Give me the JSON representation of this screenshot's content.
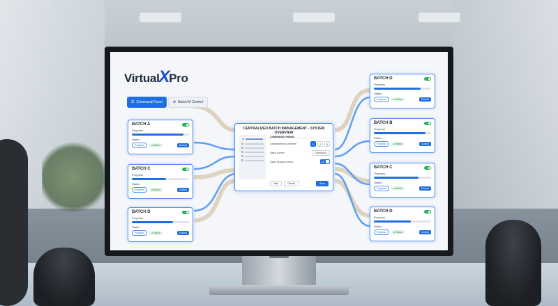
{
  "brand": {
    "name_prefix": "Virtual",
    "name_x": "X",
    "name_suffix": "Pro"
  },
  "tabs": [
    {
      "label": "Command Panel",
      "icon": "list-icon",
      "active": true
    },
    {
      "label": "Batch M Control",
      "icon": "gear-icon",
      "active": false
    }
  ],
  "panel": {
    "title": "CENTRALIZED BATCH MANAGEMENT - SYSTEM OVERVIEW",
    "heading": "COMMAND PANEL",
    "row1_label": "Centralversion cotement",
    "nums": [
      "1",
      "2",
      "3"
    ],
    "row2_label": "Satch current",
    "select_value": "Command",
    "row3_label": "Glose sirossa control",
    "switch_label": "Cil",
    "help": "Help",
    "cancel": "Cancel",
    "save": "Save"
  },
  "cards": [
    {
      "title": "BATCH A",
      "progress_label": "Progress",
      "progress": 0.9,
      "status_label": "Status",
      "pill": "Progress",
      "status": "Status",
      "control": "Control"
    },
    {
      "title": "BATCH C",
      "progress_label": "Progress",
      "progress": 0.6,
      "status_label": "Status",
      "pill": "Progress",
      "status": "Status",
      "control": "Control"
    },
    {
      "title": "BATCH D",
      "progress_label": "Progress",
      "progress": 0.72,
      "status_label": "Status",
      "pill": "Progress",
      "status": "Status",
      "control": "Control"
    },
    {
      "title": "BATCH D",
      "progress_label": "Progress",
      "progress": 0.82,
      "status_label": "Status",
      "pill": "Progress",
      "status": "Status",
      "control": "Control"
    },
    {
      "title": "BATCH B",
      "progress_label": "Progress",
      "progress": 0.9,
      "status_label": "Status",
      "pill": "Progress",
      "status": "Status",
      "control": "Control"
    },
    {
      "title": "BATCH C",
      "progress_label": "Progress",
      "progress": 0.78,
      "status_label": "Status",
      "pill": "Progress",
      "status": "Status",
      "control": "Control"
    },
    {
      "title": "BATCH D",
      "progress_label": "Progress",
      "progress": 0.65,
      "status_label": "Status",
      "pill": "Progress",
      "status": "Status",
      "control": "Control"
    }
  ],
  "colors": {
    "accent": "#1f6fe0",
    "status_green": "#2bb25a",
    "wire_blue": "#5c9ef2",
    "wire_tan": "#d8cbb2"
  }
}
